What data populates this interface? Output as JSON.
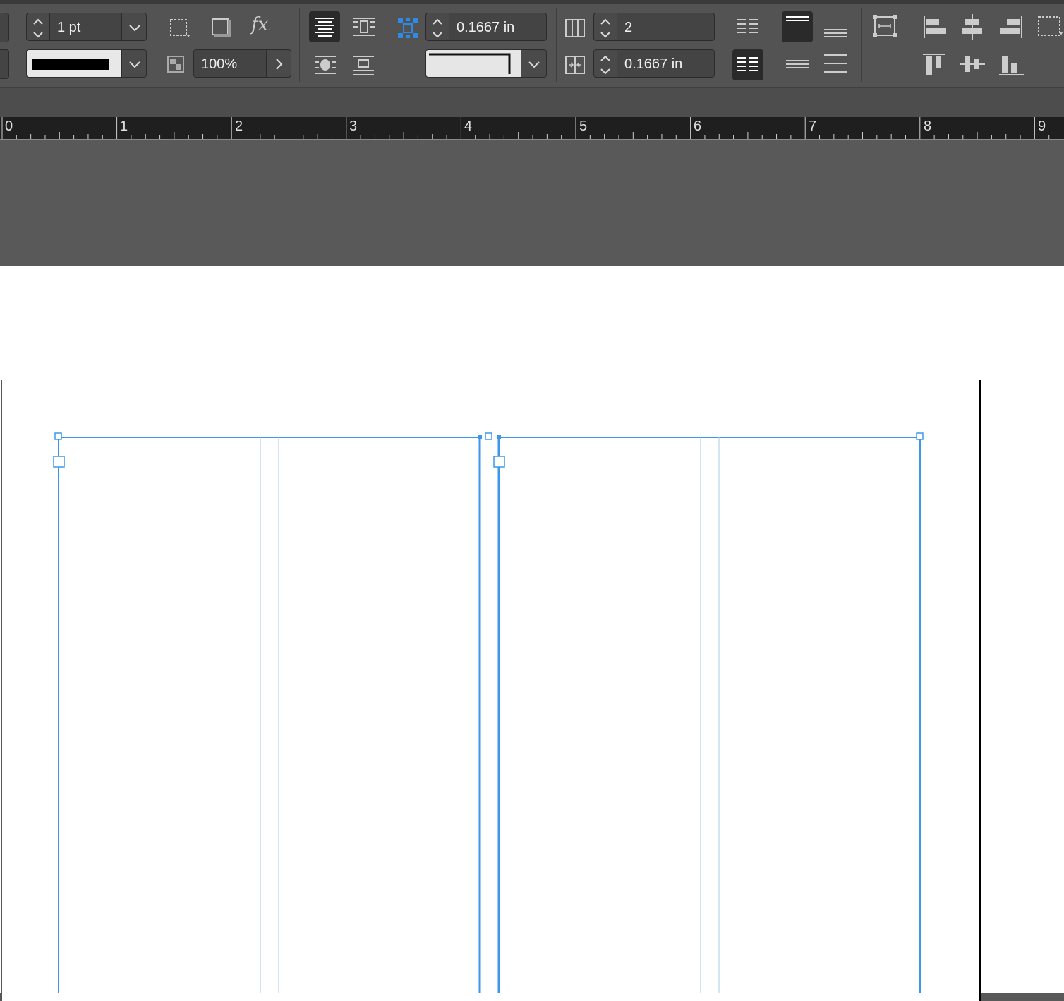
{
  "control_bar": {
    "stroke_weight": "1 pt",
    "opacity": "100%",
    "gutter_top": "0.1667 in",
    "columns": "2",
    "gutter": "0.1667 in"
  },
  "ruler": {
    "marks": [
      "0",
      "1",
      "2",
      "3",
      "4",
      "5",
      "6",
      "7",
      "8",
      "9"
    ]
  },
  "colors": {
    "frame_selection": "#3d97e8",
    "chrome_dark": "#535353",
    "pasteboard": "#595959"
  },
  "icons": {
    "stroke_spinner": "spinner-icon",
    "text_wrap_none": "wrap-none-icon",
    "shadow": "drop-shadow-icon",
    "effects": "fx-icon",
    "align_center": "align-center-icon",
    "columns": "columns-icon",
    "gutter": "gutter-icon",
    "align_left_edges": "align-left-icon",
    "align_hcenter": "align-hcenter-icon",
    "align_right_edges": "align-right-icon",
    "align_top": "align-top-icon",
    "align_vcenter": "align-vcenter-icon",
    "align_bottom": "align-bottom-icon"
  }
}
